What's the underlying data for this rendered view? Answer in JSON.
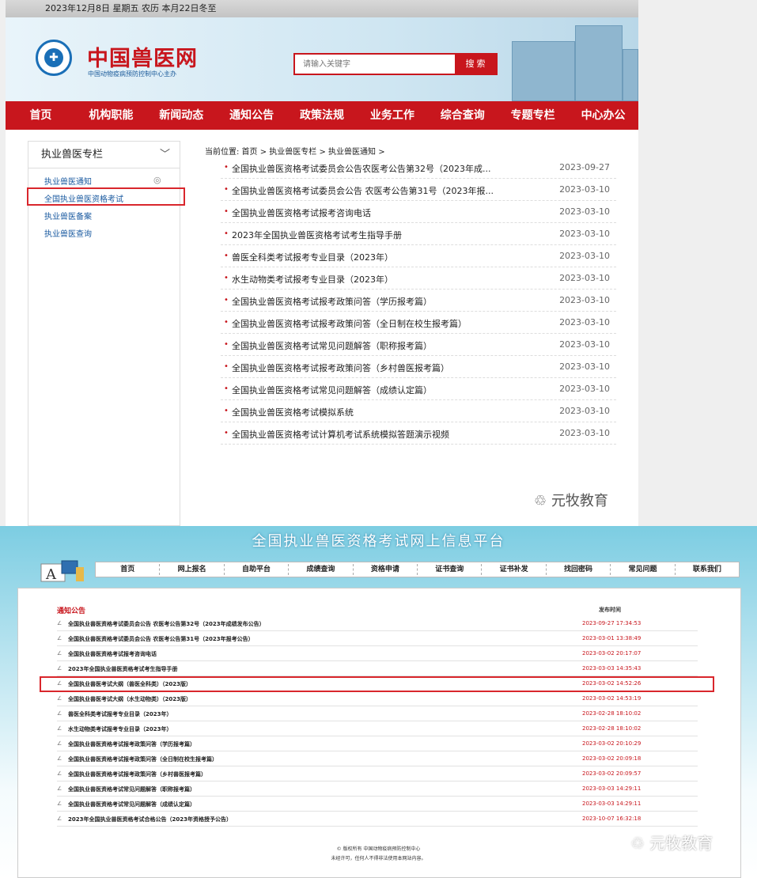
{
  "top": {
    "date_text": "2023年12月8日 星期五 农历 本月22日冬至",
    "site_title": "中国兽医网",
    "site_subtitle": "中国动物疫病预防控制中心主办",
    "search": {
      "placeholder": "请输入关键字",
      "button": "搜 索"
    },
    "nav": [
      "首页",
      "机构职能",
      "新闻动态",
      "通知公告",
      "政策法规",
      "业务工作",
      "综合查询",
      "专题专栏",
      "中心办公"
    ],
    "sidebar": {
      "heading": "执业兽医专栏",
      "items": [
        "执业兽医通知",
        "全国执业兽医资格考试",
        "执业兽医备案",
        "执业兽医查询"
      ]
    },
    "breadcrumb": "当前位置: 首页 > 执业兽医专栏 > 执业兽医通知 >",
    "list": [
      {
        "title": "全国执业兽医资格考试委员会公告农医考公告第32号（2023年成...",
        "date": "2023-09-27"
      },
      {
        "title": "全国执业兽医资格考试委员会公告 农医考公告第31号（2023年报...",
        "date": "2023-03-10"
      },
      {
        "title": "全国执业兽医资格考试报考咨询电话",
        "date": "2023-03-10"
      },
      {
        "title": "2023年全国执业兽医资格考试考生指导手册",
        "date": "2023-03-10"
      },
      {
        "title": "兽医全科类考试报考专业目录（2023年）",
        "date": "2023-03-10"
      },
      {
        "title": "水生动物类考试报考专业目录（2023年）",
        "date": "2023-03-10"
      },
      {
        "title": "全国执业兽医资格考试报考政策问答（学历报考篇）",
        "date": "2023-03-10"
      },
      {
        "title": "全国执业兽医资格考试报考政策问答（全日制在校生报考篇）",
        "date": "2023-03-10"
      },
      {
        "title": "全国执业兽医资格考试常见问题解答（职称报考篇）",
        "date": "2023-03-10"
      },
      {
        "title": "全国执业兽医资格考试报考政策问答（乡村兽医报考篇）",
        "date": "2023-03-10"
      },
      {
        "title": "全国执业兽医资格考试常见问题解答（成绩认定篇）",
        "date": "2023-03-10"
      },
      {
        "title": "全国执业兽医资格考试模拟系统",
        "date": "2023-03-10"
      },
      {
        "title": "全国执业兽医资格考试计算机考试系统模拟答题演示视频",
        "date": "2023-03-10"
      }
    ],
    "watermark": "元牧教育"
  },
  "bottom": {
    "title": "全国执业兽医资格考试网上信息平台",
    "nav": [
      "首页",
      "网上报名",
      "自助平台",
      "成绩查询",
      "资格申请",
      "证书查询",
      "证书补发",
      "找回密码",
      "常见问题",
      "联系我们"
    ],
    "section_heading": "通知公告",
    "column_header": "发布时间",
    "list": [
      {
        "title": "全国执业兽医资格考试委员会公告 农医考公告第32号（2023年成绩发布公告）",
        "date": "2023-09-27 17:34:53"
      },
      {
        "title": "全国执业兽医资格考试委员会公告 农医考公告第31号（2023年报考公告）",
        "date": "2023-03-01 13:38:49"
      },
      {
        "title": "全国执业兽医资格考试报考咨询电话",
        "date": "2023-03-02 20:17:07"
      },
      {
        "title": "2023年全国执业兽医资格考试考生指导手册",
        "date": "2023-03-03 14:35:43"
      },
      {
        "title": "全国执业兽医考试大纲（兽医全科类）（2023版）",
        "date": "2023-03-02 14:52:26"
      },
      {
        "title": "全国执业兽医考试大纲（水生动物类）（2023版）",
        "date": "2023-03-02 14:53:19"
      },
      {
        "title": "兽医全科类考试报考专业目录（2023年）",
        "date": "2023-02-28 18:10:02"
      },
      {
        "title": "水生动物类考试报考专业目录（2023年）",
        "date": "2023-02-28 18:10:02"
      },
      {
        "title": "全国执业兽医资格考试报考政策问答（学历报考篇）",
        "date": "2023-03-02 20:10:29"
      },
      {
        "title": "全国执业兽医资格考试报考政策问答（全日制在校生报考篇）",
        "date": "2023-03-02 20:09:18"
      },
      {
        "title": "全国执业兽医资格考试报考政策问答（乡村兽医报考篇）",
        "date": "2023-03-02 20:09:57"
      },
      {
        "title": "全国执业兽医资格考试常见问题解答（职称报考篇）",
        "date": "2023-03-03 14:29:11"
      },
      {
        "title": "全国执业兽医资格考试常见问题解答（成绩认定篇）",
        "date": "2023-03-03 14:29:11"
      },
      {
        "title": "2023年全国执业兽医资格考试合格公告（2023年资格授予公告）",
        "date": "2023-10-07 16:32:18"
      }
    ],
    "footer_line1": "© 版权所有 中国动物疫病预防控制中心",
    "footer_line2": "未经许可，任何人不得非法使用本网站内容。",
    "watermark": "元牧教育"
  }
}
